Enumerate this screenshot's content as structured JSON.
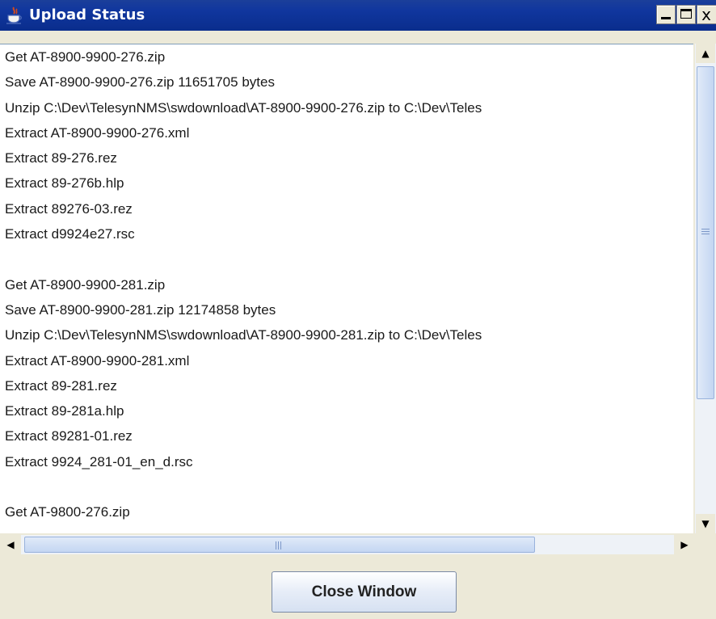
{
  "window": {
    "title": "Upload Status",
    "title_icon": "java-coffee-cup-icon",
    "controls": {
      "minimize_icon": "minimize-icon",
      "maximize_icon": "maximize-icon",
      "close_glyph": "x"
    }
  },
  "log": {
    "lines": [
      "Get AT-8900-9900-276.zip",
      "Save AT-8900-9900-276.zip 11651705 bytes",
      "Unzip C:\\Dev\\TelesynNMS\\swdownload\\AT-8900-9900-276.zip to C:\\Dev\\Teles",
      "Extract AT-8900-9900-276.xml",
      "Extract 89-276.rez",
      "Extract 89-276b.hlp",
      "Extract 89276-03.rez",
      "Extract d9924e27.rsc",
      "",
      "Get AT-8900-9900-281.zip",
      "Save AT-8900-9900-281.zip 12174858 bytes",
      "Unzip C:\\Dev\\TelesynNMS\\swdownload\\AT-8900-9900-281.zip to C:\\Dev\\Teles",
      "Extract AT-8900-9900-281.xml",
      "Extract 89-281.rez",
      "Extract 89-281a.hlp",
      "Extract 89281-01.rez",
      "Extract 9924_281-01_en_d.rsc",
      "",
      "Get AT-9800-276.zip"
    ]
  },
  "scrollbars": {
    "vertical": {
      "up_arrow": "▲",
      "down_arrow": "▼"
    },
    "horizontal": {
      "left_arrow": "◀",
      "right_arrow": "▶"
    }
  },
  "actions": {
    "close_label": "Close Window"
  },
  "colors": {
    "titlebar": "#0a2d8c",
    "background": "#ece9d8",
    "text_area": "#ffffff",
    "scroll_thumb": "#c4d6f2"
  }
}
